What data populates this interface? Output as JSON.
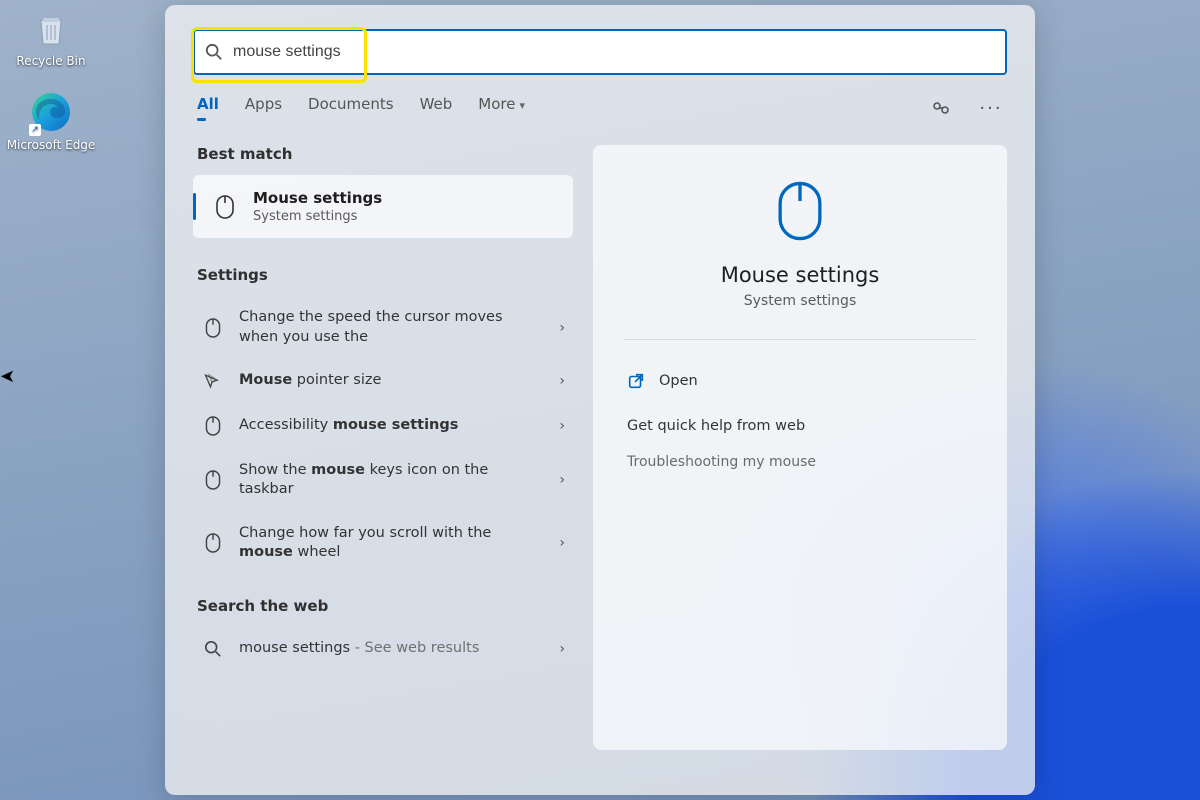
{
  "desktop": {
    "icons": [
      {
        "label": "Recycle Bin"
      },
      {
        "label": "Microsoft Edge"
      }
    ]
  },
  "search": {
    "query": "mouse settings"
  },
  "tabs": [
    "All",
    "Apps",
    "Documents",
    "Web",
    "More"
  ],
  "sections": {
    "best_match": "Best match",
    "settings": "Settings",
    "search_web": "Search the web"
  },
  "best_match": {
    "title": "Mouse settings",
    "subtitle": "System settings"
  },
  "settings_results": [
    {
      "label": "Change the speed the cursor moves when you use the"
    },
    {
      "bold": "Mouse",
      "rest": "pointer size"
    },
    {
      "pre": "Accessibility",
      "bold": "mouse settings"
    },
    {
      "pre": "Show the",
      "bold": "mouse",
      "post": "keys icon on the taskbar"
    },
    {
      "pre": "Change how far you scroll with the",
      "bold": "mouse",
      "post": "wheel"
    }
  ],
  "web_result": {
    "query": "mouse settings",
    "suffix": "See web results"
  },
  "preview": {
    "title": "Mouse settings",
    "subtitle": "System settings",
    "actions": [
      "Open"
    ],
    "help_heading": "Get quick help from web",
    "help_links": [
      "Troubleshooting my mouse"
    ]
  }
}
